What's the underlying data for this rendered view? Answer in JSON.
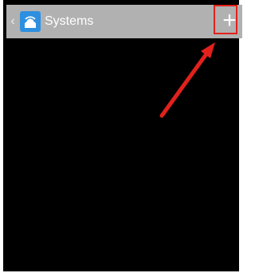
{
  "header": {
    "back_icon": "chevron-left-icon",
    "app_icon": "wifi-home-icon",
    "title": "Systems",
    "add_icon": "plus-icon",
    "add_label": "+"
  },
  "annotation": {
    "highlight_color": "#e2211c",
    "arrow_color": "#e2211c"
  },
  "colors": {
    "appbar": "#b1b1b1",
    "app_icon_bg": "#2d8fe0",
    "content_bg": "#000000"
  }
}
